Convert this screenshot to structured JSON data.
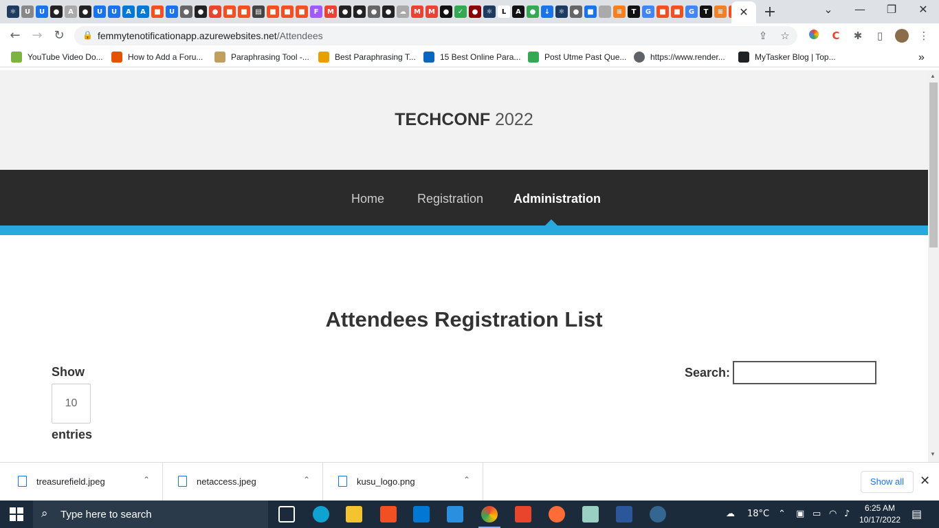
{
  "browser": {
    "url_host": "femmytenotificationapp.azurewebsites.net",
    "url_path": "/Attendees",
    "tab_close": "✕",
    "new_tab": "+",
    "bookmarks": [
      {
        "label": "YouTube Video Do...",
        "color": "#7cb342"
      },
      {
        "label": "How to Add a Foru...",
        "color": "#e65100"
      },
      {
        "label": "Paraphrasing Tool -...",
        "color": "#c0a060"
      },
      {
        "label": "Best Paraphrasing T...",
        "color": "#e6a100"
      },
      {
        "label": "15 Best Online Para...",
        "color": "#0a66c2"
      },
      {
        "label": "Post Utme Past Que...",
        "color": "#34a853"
      },
      {
        "label": "https://www.render...",
        "color": "#5f6368"
      },
      {
        "label": "MyTasker Blog | Top...",
        "color": "#202124"
      }
    ],
    "bookmarks_more": "»"
  },
  "site": {
    "brand_bold": "TECHCONF",
    "brand_year": "2022",
    "nav": [
      {
        "label": "Home"
      },
      {
        "label": "Registration"
      },
      {
        "label": "Administration"
      }
    ],
    "heading": "Attendees Registration List",
    "show_label": "Show",
    "length_value": "10",
    "entries_label": "entries",
    "search_label": "Search:",
    "search_value": ""
  },
  "downloads": {
    "items": [
      {
        "name": "treasurefield.jpeg"
      },
      {
        "name": "netaccess.jpeg"
      },
      {
        "name": "kusu_logo.png"
      }
    ],
    "show_all": "Show all"
  },
  "taskbar": {
    "search_placeholder": "Type here to search",
    "weather": "18°C",
    "time": "6:25 AM",
    "date": "10/17/2022",
    "notification_count": "1"
  },
  "colors": {
    "accent_blue": "#29a8e0",
    "nav_bg": "#2b2b2b",
    "hero_bg": "#f2f2f2"
  }
}
